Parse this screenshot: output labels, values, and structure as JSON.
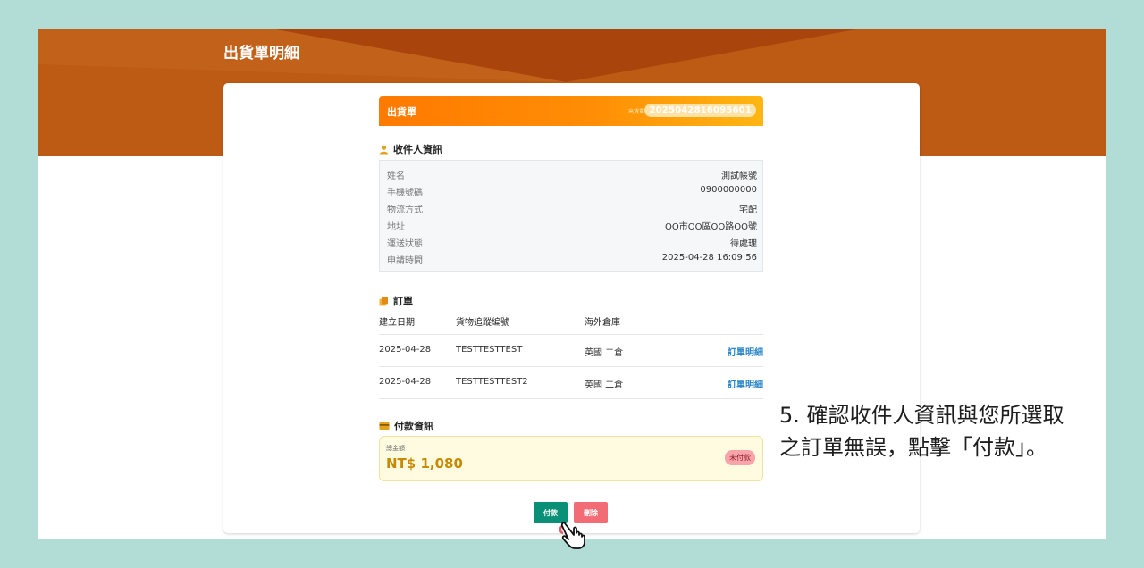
{
  "page": {
    "title": "出貨單明細"
  },
  "shipment": {
    "header_title": "出貨單",
    "number_label": "出貨單號",
    "number": "2025042816095601",
    "colors": {
      "header_start": "#ff7a00",
      "header_end": "#ffb612"
    }
  },
  "recipient": {
    "section_title": "收件人資訊",
    "section_icon": "user-icon",
    "rows": [
      {
        "label": "姓名",
        "value": "測試帳號"
      },
      {
        "label": "手機號碼",
        "value": "0900000000"
      },
      {
        "label": "物流方式",
        "value": "宅配"
      },
      {
        "label": "地址",
        "value": "OO市OO區OO路OO號"
      },
      {
        "label": "運送狀態",
        "value": "待處理"
      },
      {
        "label": "申請時間",
        "value": "2025-04-28 16:09:56"
      }
    ]
  },
  "orders": {
    "section_title": "訂單",
    "section_icon": "copy-icon",
    "columns": [
      "建立日期",
      "貨物追蹤編號",
      "海外倉庫"
    ],
    "rows": [
      {
        "date": "2025-04-28",
        "tracking": "TESTTESTTEST",
        "warehouse": "英國 二倉",
        "link": "訂單明細"
      },
      {
        "date": "2025-04-28",
        "tracking": "TESTTESTTEST2",
        "warehouse": "英國 二倉",
        "link": "訂單明細"
      }
    ]
  },
  "payment": {
    "section_title": "付款資訊",
    "section_icon": "credit-card-icon",
    "total_label": "總金額",
    "total_amount": "NT$ 1,080",
    "status": "未付款"
  },
  "actions": {
    "pay_label": "付款",
    "delete_label": "刪除"
  },
  "instruction": {
    "line1": "5. 確認收件人資訊與您所選取",
    "line2": "之訂單無誤，點擊「付款」。"
  }
}
